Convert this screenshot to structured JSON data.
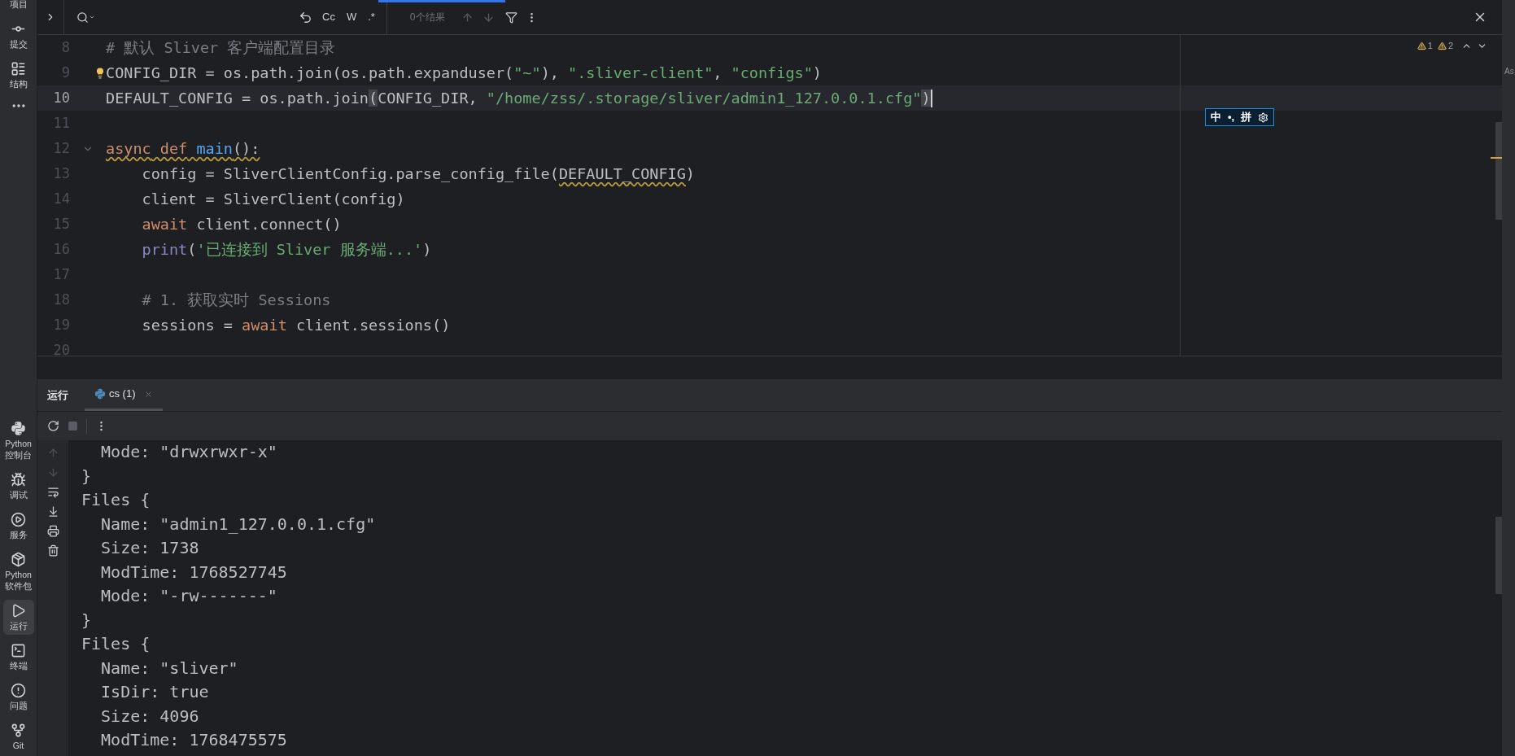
{
  "sidebar": {
    "top": [
      {
        "label": "项目",
        "selected": false
      },
      {
        "label": "提交",
        "selected": false
      },
      {
        "label": "结构",
        "selected": false
      }
    ],
    "bottom": [
      {
        "label": "Python控制台",
        "selected": false
      },
      {
        "label": "调试",
        "selected": false
      },
      {
        "label": "服务",
        "selected": false
      },
      {
        "label": "Python软件包",
        "selected": false
      },
      {
        "label": "运行",
        "selected": true
      },
      {
        "label": "终端",
        "selected": false
      },
      {
        "label": "问题",
        "selected": false
      },
      {
        "label": "Git",
        "selected": false
      }
    ]
  },
  "find_bar": {
    "options": [
      "Cc",
      "W",
      ".*"
    ],
    "results": "0个结果"
  },
  "editor": {
    "warnings": [
      "1",
      "2"
    ],
    "lines": [
      {
        "number": "8",
        "current": false,
        "tokens": [
          {
            "kind": "comment",
            "text": "# 默认 Sliver 客户端配置目录"
          }
        ]
      },
      {
        "number": "9",
        "current": false,
        "hint": true,
        "tokens": [
          {
            "kind": "plain",
            "text": "CONFIG_DIR = os.path.join(os.path.expanduser("
          },
          {
            "kind": "string",
            "text": "\"~\""
          },
          {
            "kind": "plain",
            "text": "), "
          },
          {
            "kind": "string",
            "text": "\".sliver-client\""
          },
          {
            "kind": "plain",
            "text": ", "
          },
          {
            "kind": "string",
            "text": "\"configs\""
          },
          {
            "kind": "plain",
            "text": ")"
          }
        ]
      },
      {
        "number": "10",
        "current": true,
        "tokens": [
          {
            "kind": "plain",
            "text": "DEFAULT_CONFIG = os.path.join"
          },
          {
            "kind": "match",
            "text": "("
          },
          {
            "kind": "plain",
            "text": "CONFIG_DIR, "
          },
          {
            "kind": "string",
            "text": "\"/home/zss/.storage/sliver/admin1_127.0.0.1.cfg\""
          },
          {
            "kind": "match",
            "text": ")"
          }
        ]
      },
      {
        "number": "11",
        "current": false
      },
      {
        "number": "12",
        "current": false,
        "foldable": true,
        "tokens": [
          {
            "kind": "keyword",
            "text": "async",
            "warn": true
          },
          {
            "kind": "keyword",
            "text": " def",
            "warn": true
          },
          {
            "kind": "function",
            "text": " main",
            "warn": true
          },
          {
            "kind": "plain",
            "text": "():",
            "warn": true
          }
        ]
      },
      {
        "number": "13",
        "current": false,
        "tokens": [
          {
            "kind": "plain",
            "text": "    config = SliverClientConfig.parse_config_file("
          },
          {
            "kind": "plain",
            "text": "DEFAULT_CONFIG",
            "warn": true
          },
          {
            "kind": "plain",
            "text": ")"
          }
        ]
      },
      {
        "number": "14",
        "current": false,
        "tokens": [
          {
            "kind": "plain",
            "text": "    client = SliverClient(config)"
          }
        ]
      },
      {
        "number": "15",
        "current": false,
        "tokens": [
          {
            "kind": "keyword",
            "text": "    await"
          },
          {
            "kind": "plain",
            "text": " client.connect()"
          }
        ]
      },
      {
        "number": "16",
        "current": false,
        "tokens": [
          {
            "kind": "builtin",
            "text": "    print"
          },
          {
            "kind": "plain",
            "text": "("
          },
          {
            "kind": "string",
            "text": "'已连接到 Sliver 服务端...'"
          },
          {
            "kind": "plain",
            "text": ")"
          }
        ]
      },
      {
        "number": "17",
        "current": false
      },
      {
        "number": "18",
        "current": false,
        "tokens": [
          {
            "kind": "comment",
            "text": "    # 1. 获取实时 Sessions"
          }
        ]
      },
      {
        "number": "19",
        "current": false,
        "tokens": [
          {
            "kind": "plain",
            "text": "    sessions = "
          },
          {
            "kind": "keyword",
            "text": "await"
          },
          {
            "kind": "plain",
            "text": " client.sessions()"
          }
        ]
      },
      {
        "number": "20",
        "current": false
      }
    ]
  },
  "ime": {
    "items": [
      "中",
      "•,",
      "拼"
    ]
  },
  "run_panel": {
    "title": "运行",
    "tabs": [
      {
        "label": "cs (1)",
        "selected": true
      }
    ],
    "console": [
      "  Mode: \"drwxrwxr-x\"",
      "}",
      "Files {",
      "  Name: \"admin1_127.0.0.1.cfg\"",
      "  Size: 1738",
      "  ModTime: 1768527745",
      "  Mode: \"-rw-------\"",
      "}",
      "Files {",
      "  Name: \"sliver\"",
      "  IsDir: true",
      "  Size: 4096",
      "  ModTime: 1768475575"
    ]
  },
  "right_strip": {
    "label": "As"
  }
}
